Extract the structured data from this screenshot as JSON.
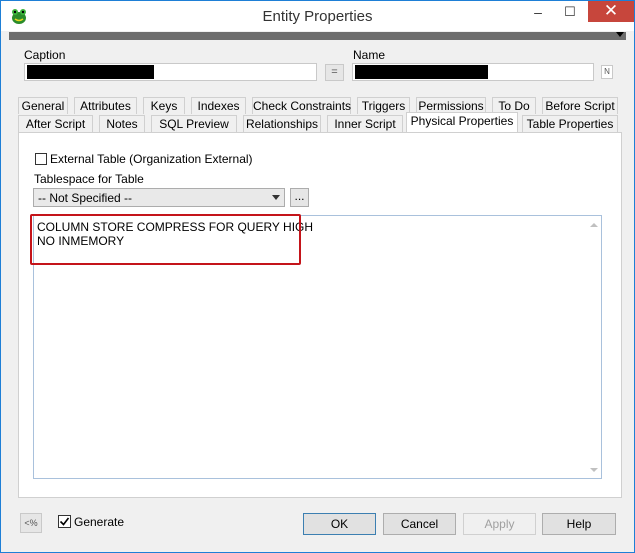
{
  "window": {
    "title": "Entity Properties",
    "controls": {
      "minimize": "–",
      "maximize": "☐",
      "close": "✕"
    }
  },
  "fields": {
    "caption_label": "Caption",
    "equal_button": "=",
    "name_label": "Name",
    "name_side_button": "N"
  },
  "tabs": {
    "row1": [
      "General",
      "Attributes",
      "Keys",
      "Indexes",
      "Check Constraints",
      "Triggers",
      "Permissions",
      "To Do",
      "Before Script"
    ],
    "row2": [
      "After Script",
      "Notes",
      "SQL Preview",
      "Relationships",
      "Inner Script",
      "Physical Properties",
      "Table Properties"
    ],
    "active": "Physical Properties"
  },
  "physical": {
    "external_table_label": "External Table (Organization External)",
    "external_table_checked": false,
    "tablespace_label": "Tablespace for Table",
    "tablespace_value": "-- Not Specified --",
    "browse_button": "...",
    "script_lines": [
      "COLUMN STORE COMPRESS FOR QUERY HIGH",
      "NO INMEMORY"
    ]
  },
  "footer": {
    "left_icon_label": "<%",
    "generate_label": "Generate",
    "generate_checked": true,
    "ok": "OK",
    "cancel": "Cancel",
    "apply": "Apply",
    "help": "Help"
  },
  "colors": {
    "close_button": "#c7463c",
    "highlight_box": "#c4141a",
    "window_border": "#1e7fd6"
  }
}
